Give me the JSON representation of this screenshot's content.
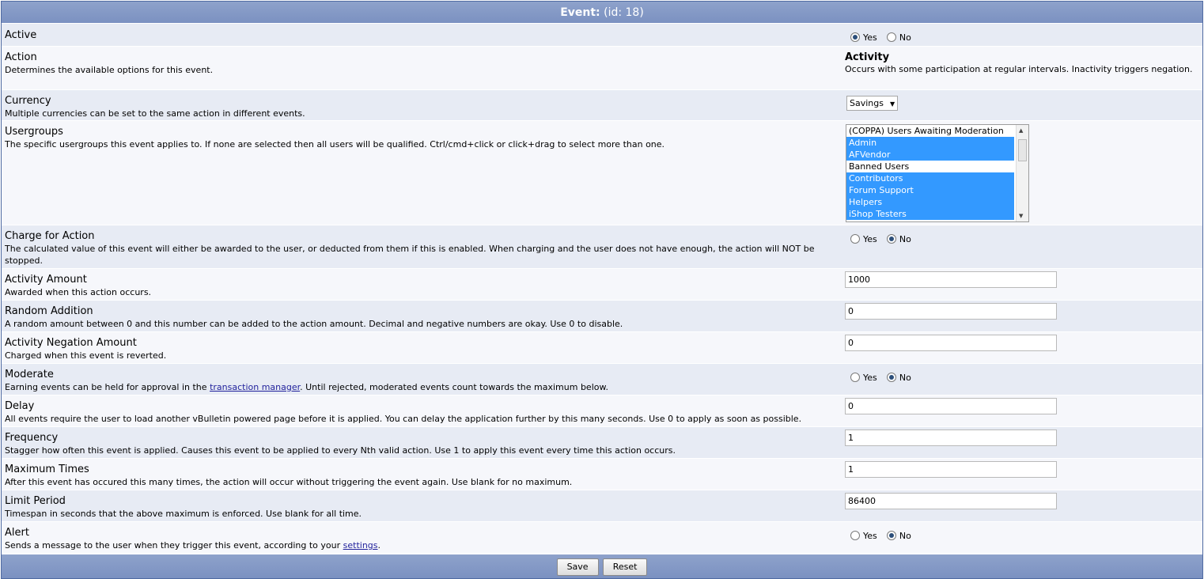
{
  "header": {
    "title": "Event:",
    "id_text": "(id: 18)"
  },
  "rows": {
    "active": {
      "title": "Active",
      "yes": "Yes",
      "no": "No"
    },
    "action": {
      "title": "Action",
      "desc": "Determines the available options for this event.",
      "value_title": "Activity",
      "value_desc": "Occurs with some participation at regular intervals. Inactivity triggers negation."
    },
    "currency": {
      "title": "Currency",
      "desc": "Multiple currencies can be set to the same action in different events.",
      "selected": "Savings"
    },
    "usergroups": {
      "title": "Usergroups",
      "desc": "The specific usergroups this event applies to. If none are selected then all users will be qualified. Ctrl/cmd+click or click+drag to select more than one.",
      "options": [
        {
          "label": "(COPPA) Users Awaiting Moderation",
          "selected": false
        },
        {
          "label": "Admin",
          "selected": true
        },
        {
          "label": "AFVendor",
          "selected": true
        },
        {
          "label": "Banned Users",
          "selected": false
        },
        {
          "label": "Contributors",
          "selected": true
        },
        {
          "label": "Forum Support",
          "selected": true
        },
        {
          "label": "Helpers",
          "selected": true
        },
        {
          "label": "iShop Testers",
          "selected": true
        }
      ]
    },
    "charge": {
      "title": "Charge for Action",
      "desc": "The calculated value of this event will either be awarded to the user, or deducted from them if this is enabled. When charging and the user does not have enough, the action will NOT be stopped.",
      "yes": "Yes",
      "no": "No"
    },
    "amount": {
      "title": "Activity Amount",
      "desc": "Awarded when this action occurs.",
      "value": "1000"
    },
    "random": {
      "title": "Random Addition",
      "desc": "A random amount between 0 and this number can be added to the action amount. Decimal and negative numbers are okay. Use 0 to disable.",
      "value": "0"
    },
    "negation": {
      "title": "Activity Negation Amount",
      "desc": "Charged when this event is reverted.",
      "value": "0"
    },
    "moderate": {
      "title": "Moderate",
      "desc_before": "Earning events can be held for approval in the ",
      "link": "transaction manager",
      "desc_after": ". Until rejected, moderated events count towards the maximum below.",
      "yes": "Yes",
      "no": "No"
    },
    "delay": {
      "title": "Delay",
      "desc": "All events require the user to load another vBulletin powered page before it is applied. You can delay the application further by this many seconds. Use 0 to apply as soon as possible.",
      "value": "0"
    },
    "frequency": {
      "title": "Frequency",
      "desc": "Stagger how often this event is applied. Causes this event to be applied to every Nth valid action. Use 1 to apply this event every time this action occurs.",
      "value": "1"
    },
    "maximum": {
      "title": "Maximum Times",
      "desc": "After this event has occured this many times, the action will occur without triggering the event again. Use blank for no maximum.",
      "value": "1"
    },
    "limit": {
      "title": "Limit Period",
      "desc": "Timespan in seconds that the above maximum is enforced. Use blank for all time.",
      "value": "86400"
    },
    "alert": {
      "title": "Alert",
      "desc_before": "Sends a message to the user when they trigger this event, according to your ",
      "link": "settings",
      "desc_after": ".",
      "yes": "Yes",
      "no": "No"
    }
  },
  "buttons": {
    "save": "Save",
    "reset": "Reset"
  },
  "colors": {
    "header": "#7b91c1",
    "row_a": "#e7ebf4",
    "row_b": "#f6f7fb",
    "selected": "#3399ff"
  }
}
